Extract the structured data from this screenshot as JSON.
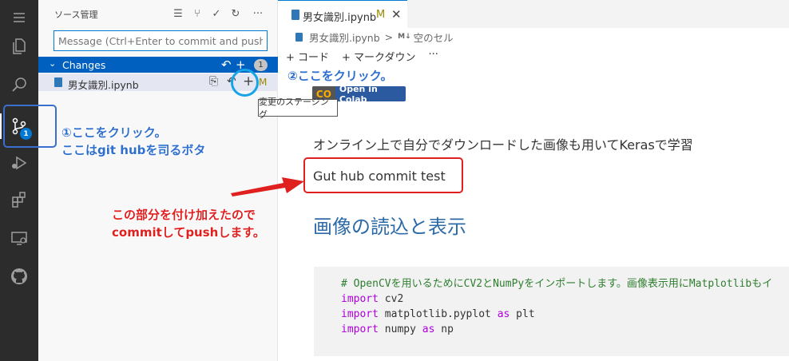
{
  "activity_bar": {
    "items": [
      {
        "name": "menu-icon"
      },
      {
        "name": "explorer-icon"
      },
      {
        "name": "search-icon"
      },
      {
        "name": "source-control-icon",
        "badge": "1",
        "active": true
      },
      {
        "name": "run-debug-icon"
      },
      {
        "name": "extensions-icon"
      },
      {
        "name": "remote-explorer-icon"
      },
      {
        "name": "github-icon"
      }
    ]
  },
  "sidebar": {
    "title": "ソース管理",
    "commit_placeholder": "Message (Ctrl+Enter to commit and push t...",
    "changes": {
      "label": "Changes",
      "count": "1",
      "files": [
        {
          "name": "男女識別.ipynb",
          "status": "M"
        }
      ]
    },
    "tooltip": "変更のステージング"
  },
  "editor": {
    "tab": {
      "label": "男女識別.ipynb",
      "modified": "M",
      "close": "✕"
    },
    "breadcrumb": {
      "file": "男女識別.ipynb",
      "separator": ">",
      "md_badge": "M↓",
      "cell": "空のセル"
    },
    "toolbar": {
      "code": "+ コード",
      "markdown": "+ マークダウン",
      "more": "···"
    },
    "colab_badge": {
      "logo": "CO",
      "label": "Open in Colab"
    },
    "markdown_line1": "オンライン上で自分でダウンロードした画像も用いてKerasで学習",
    "markdown_line2": "Gut hub commit test",
    "heading": "画像の読込と表示",
    "code": {
      "comment": "# OpenCVを用いるためにCV2とNumPyをインポートします。画像表示用にMatplotlibもイ",
      "line1_kw": "import",
      "line1_rest": " cv2",
      "line2_kw": "import",
      "line2_mid": " matplotlib.pyplot ",
      "line2_as": "as",
      "line2_rest": " plt",
      "line3_kw": "import",
      "line3_mid": " numpy ",
      "line3_as": "as",
      "line3_rest": " np"
    }
  },
  "annotations": {
    "step1_line1": "①ここをクリック。",
    "step1_line2": "ここはgit hubを司るボタ",
    "step2": "②ここをクリック。",
    "note_line1": "この部分を付け加えたので",
    "note_line2": "commitしてpushします。"
  },
  "colors": {
    "accent": "#0078d4",
    "annotation_blue": "#2f6fce",
    "annotation_red": "#e01f1f",
    "heading_blue": "#2d6aa8"
  }
}
